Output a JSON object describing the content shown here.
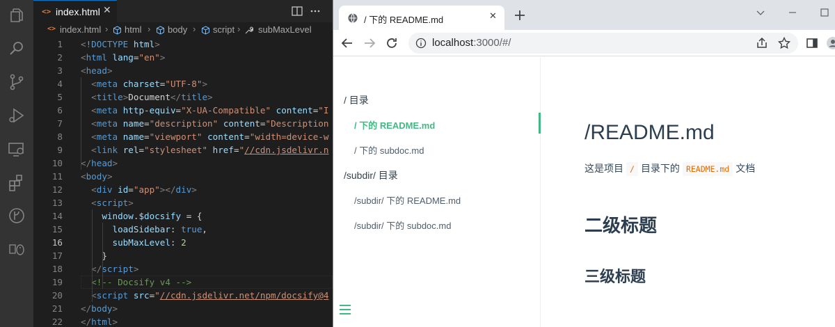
{
  "vscode": {
    "activity_icons": [
      "explorer-icon",
      "search-icon",
      "source-control-icon",
      "run-debug-icon",
      "remote-explorer-icon",
      "extensions-icon",
      "git-graph-icon",
      "linux-penguin-icon"
    ],
    "tab": {
      "label": "index.html",
      "lang_glyph": "<>",
      "close": "✕"
    },
    "breadcrumb": [
      "index.html",
      "html",
      "body",
      "script",
      "subMaxLevel"
    ],
    "active_line": 16,
    "lines": [
      {
        "n": 1,
        "html": "<span class='t-punct'>&lt;</span><span class='t-tag'>!DOCTYPE</span> <span class='t-attr'>html</span><span class='t-punct'>&gt;</span>"
      },
      {
        "n": 2,
        "html": "<span class='t-punct'>&lt;</span><span class='t-tag'>html</span> <span class='t-attr'>lang</span>=<span class='t-str'>\"en\"</span><span class='t-punct'>&gt;</span>"
      },
      {
        "n": 3,
        "html": "<span class='t-punct'>&lt;</span><span class='t-tag'>head</span><span class='t-punct'>&gt;</span>"
      },
      {
        "n": 4,
        "html": "  <span class='t-punct'>&lt;</span><span class='t-tag'>meta</span> <span class='t-attr'>charset</span>=<span class='t-str'>\"UTF-8\"</span><span class='t-punct'>&gt;</span>"
      },
      {
        "n": 5,
        "html": "  <span class='t-punct'>&lt;</span><span class='t-tag'>title</span><span class='t-punct'>&gt;</span><span class='t-text'>Document</span><span class='t-punct'>&lt;/</span><span class='t-tag'>title</span><span class='t-punct'>&gt;</span>"
      },
      {
        "n": 6,
        "html": "  <span class='t-punct'>&lt;</span><span class='t-tag'>meta</span> <span class='t-attr'>http-equiv</span>=<span class='t-str'>\"X-UA-Compatible\"</span> <span class='t-attr'>content</span>=<span class='t-str'>\"I</span>"
      },
      {
        "n": 7,
        "html": "  <span class='t-punct'>&lt;</span><span class='t-tag'>meta</span> <span class='t-attr'>name</span>=<span class='t-str'>\"description\"</span> <span class='t-attr'>content</span>=<span class='t-str'>\"Description</span>"
      },
      {
        "n": 8,
        "html": "  <span class='t-punct'>&lt;</span><span class='t-tag'>meta</span> <span class='t-attr'>name</span>=<span class='t-str'>\"viewport\"</span> <span class='t-attr'>content</span>=<span class='t-str'>\"width=device-w</span>"
      },
      {
        "n": 9,
        "html": "  <span class='t-punct'>&lt;</span><span class='t-tag'>link</span> <span class='t-attr'>rel</span>=<span class='t-str'>\"stylesheet\"</span> <span class='t-attr'>href</span>=<span class='t-str'>\"</span><span class='t-url'>//cdn.jsdelivr.n</span>"
      },
      {
        "n": 10,
        "html": "<span class='t-punct'>&lt;/</span><span class='t-tag'>head</span><span class='t-punct'>&gt;</span>"
      },
      {
        "n": 11,
        "html": "<span class='t-punct'>&lt;</span><span class='t-tag'>body</span><span class='t-punct'>&gt;</span>"
      },
      {
        "n": 12,
        "html": "  <span class='t-punct'>&lt;</span><span class='t-tag'>div</span> <span class='t-attr'>id</span>=<span class='t-str'>\"app\"</span><span class='t-punct'>&gt;&lt;/</span><span class='t-tag'>div</span><span class='t-punct'>&gt;</span>"
      },
      {
        "n": 13,
        "html": "  <span class='t-punct'>&lt;</span><span class='t-tag'>script</span><span class='t-punct'>&gt;</span>"
      },
      {
        "n": 14,
        "html": "    <span class='t-kw'>window</span>.<span class='t-kw'>$docsify</span> = {"
      },
      {
        "n": 15,
        "html": "      <span class='t-kw'>loadSidebar</span>: <span class='t-bool'>true</span>,"
      },
      {
        "n": 16,
        "html": "      <span class='t-kw'>subMaxLevel</span>: <span class='t-num'>2</span>"
      },
      {
        "n": 17,
        "html": "    }"
      },
      {
        "n": 18,
        "html": "  <span class='t-punct'>&lt;/</span><span class='t-tag'>script</span><span class='t-punct'>&gt;</span>"
      },
      {
        "n": 19,
        "html": "  <span class='t-com'>&lt;!-- Docsify v4 --&gt;</span>"
      },
      {
        "n": 20,
        "html": "  <span class='t-punct'>&lt;</span><span class='t-tag'>script</span> <span class='t-attr'>src</span>=<span class='t-str'>\"</span><span class='t-url'>//cdn.jsdelivr.net/npm/docsify@4</span>"
      },
      {
        "n": 21,
        "html": "<span class='t-punct'>&lt;/</span><span class='t-tag'>body</span><span class='t-punct'>&gt;</span>"
      },
      {
        "n": 22,
        "html": "<span class='t-punct'>&lt;/</span><span class='t-tag'>html</span><span class='t-punct'>&gt;</span>"
      }
    ]
  },
  "browser": {
    "tab_title": "/ 下的 README.md",
    "tab_close": "✕",
    "url_host": "localhost",
    "url_rest": ":3000/#/",
    "sidebar": {
      "items": [
        {
          "label": "/ 目录",
          "level": 1,
          "active": false
        },
        {
          "label": "/ 下的 README.md",
          "level": 2,
          "active": true
        },
        {
          "label": "/ 下的 subdoc.md",
          "level": 2,
          "active": false
        },
        {
          "label": "/subdir/ 目录",
          "level": 1,
          "active": false
        },
        {
          "label": "/subdir/ 下的 README.md",
          "level": 2,
          "active": false
        },
        {
          "label": "/subdir/ 下的 subdoc.md",
          "level": 2,
          "active": false
        }
      ]
    },
    "content": {
      "h1": "/README.md",
      "para_before": "这是项目",
      "code1": "/",
      "para_middle": "目录下的",
      "code2": "README.md",
      "para_after": "文档",
      "h2": "二级标题",
      "h3": "三级标题"
    },
    "accent_color": "#42b983"
  }
}
